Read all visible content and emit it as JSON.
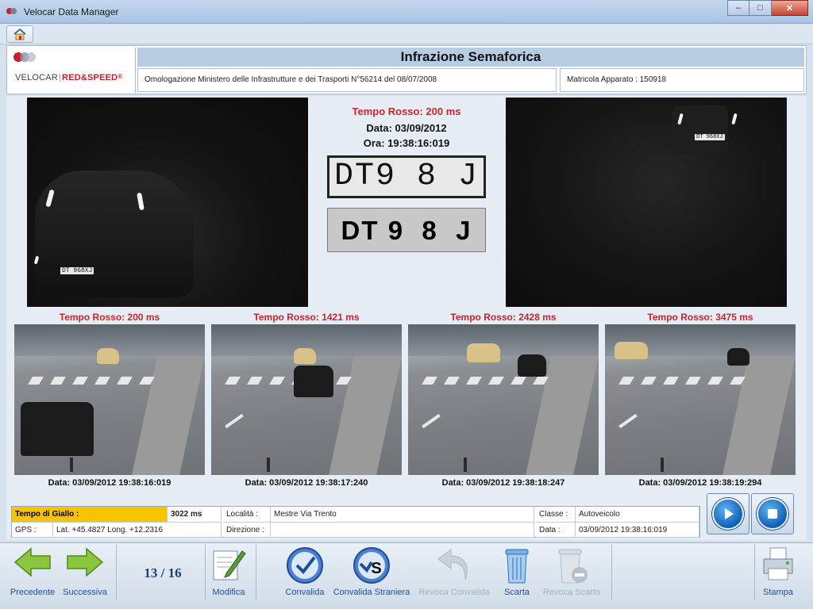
{
  "window": {
    "title": "Velocar Data Manager",
    "minimize": "–",
    "maximize": "□",
    "close": "✕"
  },
  "header": {
    "logo_part1": "VELOCAR",
    "logo_part2": "RED&SPEED",
    "logo_reg": "®",
    "title": "Infrazione Semaforica",
    "omologazione": "Omologazione Ministero delle Infrastrutture e dei Trasporti N°56214 del 08/07/2008",
    "matricola": "Matricola Apparato : 150918"
  },
  "main": {
    "tempo_rosso": "Tempo Rosso: 200 ms",
    "data": "Data: 03/09/2012",
    "ora": "Ora: 19:38:16:019",
    "plate_crop": "DT9 8 J",
    "plate_read": "DT 9  8  J",
    "left_plate": "DT 968XJ",
    "right_plate": "DT 968XJ"
  },
  "thumbnails": [
    {
      "tempo": "Tempo Rosso: 200 ms",
      "date": "Data: 03/09/2012 19:38:16:019"
    },
    {
      "tempo": "Tempo Rosso: 1421 ms",
      "date": "Data: 03/09/2012 19:38:17:240"
    },
    {
      "tempo": "Tempo Rosso: 2428 ms",
      "date": "Data: 03/09/2012 19:38:18:247"
    },
    {
      "tempo": "Tempo Rosso: 3475 ms",
      "date": "Data: 03/09/2012 19:38:19:294"
    }
  ],
  "details": {
    "giallo_label": "Tempo di Giallo :",
    "giallo_value": "3022 ms",
    "gps_label": "GPS :",
    "gps_value": "Lat. +45.4827 Long. +12.2316",
    "localita_label": "Località :",
    "localita_value": "Mestre Via Trento",
    "direzione_label": "Direzione :",
    "direzione_value": "",
    "classe_label": "Classe :",
    "classe_value": "Autoveicolo",
    "data_label": "Data :",
    "data_value": "03/09/2012 19:38:16:019"
  },
  "toolbar": {
    "precedente": "Precedente",
    "successiva": "Successiva",
    "counter": "13 / 16",
    "modifica": "Modifica",
    "convalida": "Convalida",
    "convalida_straniera": "Convalida Straniera",
    "revoca_convalida": "Revoca Convalida",
    "scarta": "Scarta",
    "revoca_scarto": "Revoca Scarto",
    "stampa": "Stampa"
  },
  "colors": {
    "accent_red": "#c8252c",
    "giallo": "#f6c400",
    "header_blue": "#b7cde4",
    "link_blue": "#1f4f96",
    "disabled": "#a5b1be"
  }
}
